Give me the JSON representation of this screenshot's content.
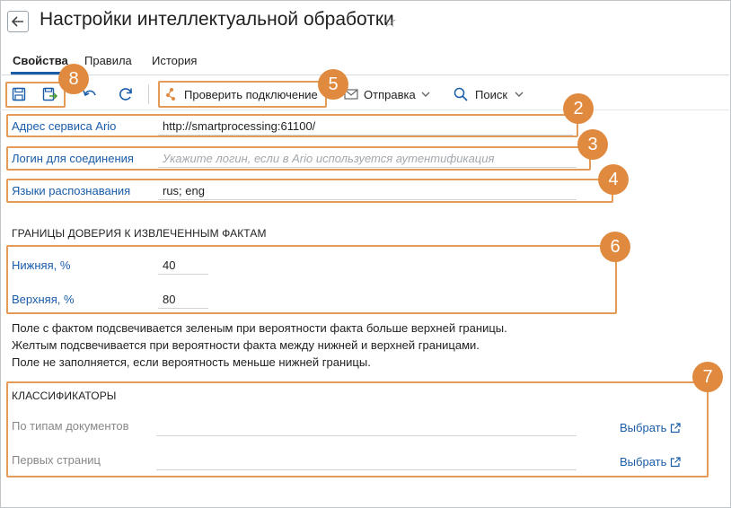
{
  "header": {
    "title": "Настройки интеллектуальной обработки",
    "back_icon": "arrow-left-icon",
    "favorite_icon": "star-outline-icon"
  },
  "tabs": [
    {
      "label": "Свойства",
      "active": true
    },
    {
      "label": "Правила",
      "active": false
    },
    {
      "label": "История",
      "active": false
    }
  ],
  "toolbar": {
    "check_connection": "Проверить подключение",
    "send": "Отправка",
    "search": "Поиск"
  },
  "fields": {
    "service_address": {
      "label": "Адрес сервиса Ario",
      "value": "http://smartprocessing:61100/"
    },
    "login": {
      "label": "Логин для соединения",
      "placeholder": "Укажите логин, если в Ario используется аутентификация"
    },
    "languages": {
      "label": "Языки распознавания",
      "value": "rus; eng"
    }
  },
  "trust": {
    "title": "ГРАНИЦЫ ДОВЕРИЯ К ИЗВЛЕЧЕННЫМ ФАКТАМ",
    "lower": {
      "label": "Нижняя, %",
      "value": "40"
    },
    "upper": {
      "label": "Верхняя, %",
      "value": "80"
    }
  },
  "description": [
    "Поле с фактом подсвечивается зеленым при вероятности факта больше верхней границы.",
    "Желтым подсвечивается при вероятности факта между нижней и верхней границами.",
    "Поле не заполняется, если вероятность меньше нижней границы."
  ],
  "classifiers": {
    "title": "КЛАССИФИКАТОРЫ",
    "by_doc_types": {
      "label": "По типам документов",
      "action": "Выбрать"
    },
    "first_pages": {
      "label": "Первых страниц",
      "action": "Выбрать"
    }
  },
  "badges": [
    "2",
    "3",
    "4",
    "5",
    "6",
    "7",
    "8"
  ],
  "colors": {
    "accent": "#1a5ca8",
    "annotation": "#e08a3f",
    "annotation_border": "#e39b57"
  }
}
